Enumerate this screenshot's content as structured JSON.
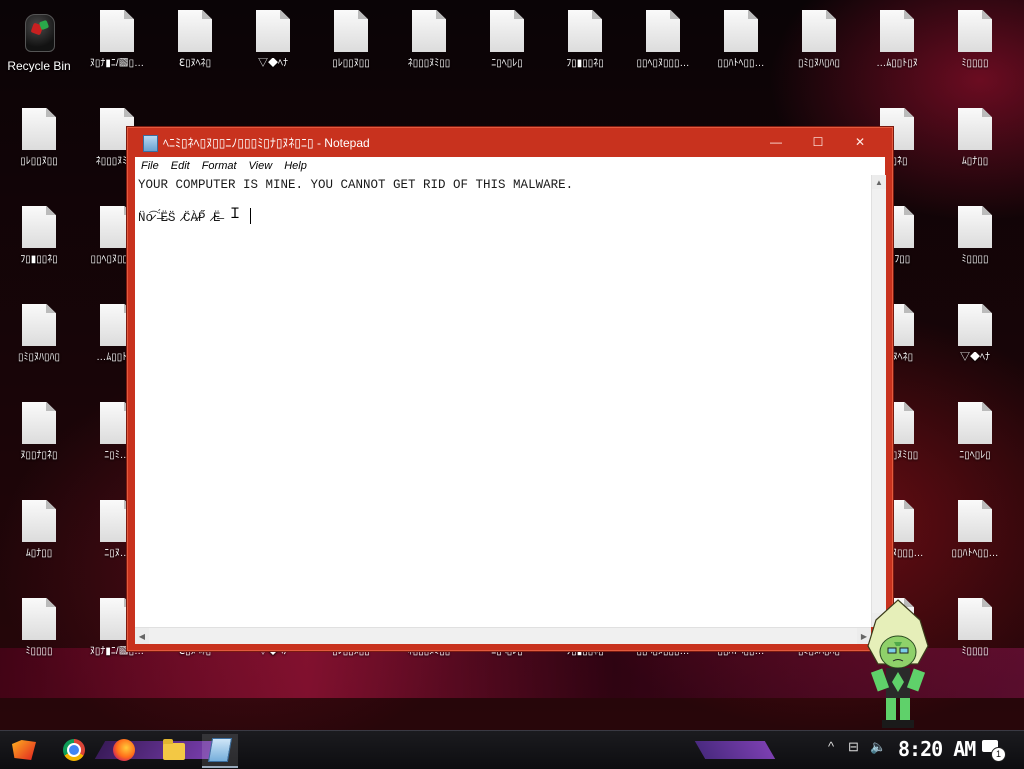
{
  "desktop": {
    "recycle_bin_label": "Recycle Bin",
    "icons": [
      "ﾇ▯ﾅ▮ﾆ/▩▯…",
      "ℇ▯ﾇﾍﾈ▯",
      "▽◆ﾍﾅ",
      "▯ﾚ▯▯ﾇ▯▯",
      "ﾈ▯▯▯ﾇﾐ▯▯",
      "ﾆ▯ﾍ▯ﾚ▯",
      "ﾌ▯▮▯▯ﾈ▯",
      "▯▯ﾍ▯ﾇ▯▯▯…",
      "▯▯ﾊﾄﾍ▯▯…",
      "▯ﾐ▯ﾇﾊ▯ﾊ▯",
      "…ﾑ▯▯ﾄ▯ﾇ",
      "ﾐ▯▯▯▯",
      "ﾇ▯▯ﾅ▯ﾈ▯",
      "ﾆ▯ﾐ…",
      "ﾍ▯ﾈ▯",
      "ﾑ▯ﾅ▯▯",
      "ﾆ▯ﾇ…",
      "ﾍ▯ﾌ▯▯",
      "ﾐ▯▯▯▯"
    ]
  },
  "notepad": {
    "title": "ﾍﾆﾐ▯ﾈﾍ▯ﾇ▯▯ﾆﾉ▯▯▯ﾐ▯ﾅ▯ﾇﾈ▯ﾆ▯ - Notepad",
    "menu": [
      "File",
      "Edit",
      "Format",
      "View",
      "Help"
    ],
    "line1": "YOUR COMPUTER IS MINE. YOU CANNOT GET RID OF THIS MALWARE.",
    "line2": "N̈o̷͡ ̶̈́Ë̵S̈ ̷C̈À̷P̋ ̷Ë̶",
    "min_glyph": "—",
    "max_glyph": "☐",
    "close_glyph": "✕"
  },
  "taskbar": {
    "time": "8:20 AM",
    "notification_count": "1",
    "tray_arrow": "^",
    "tray_network": "⊟",
    "tray_volume": "🔈"
  },
  "colors": {
    "window_frame": "#c8321e",
    "accent_purple": "#7b3fb0"
  }
}
